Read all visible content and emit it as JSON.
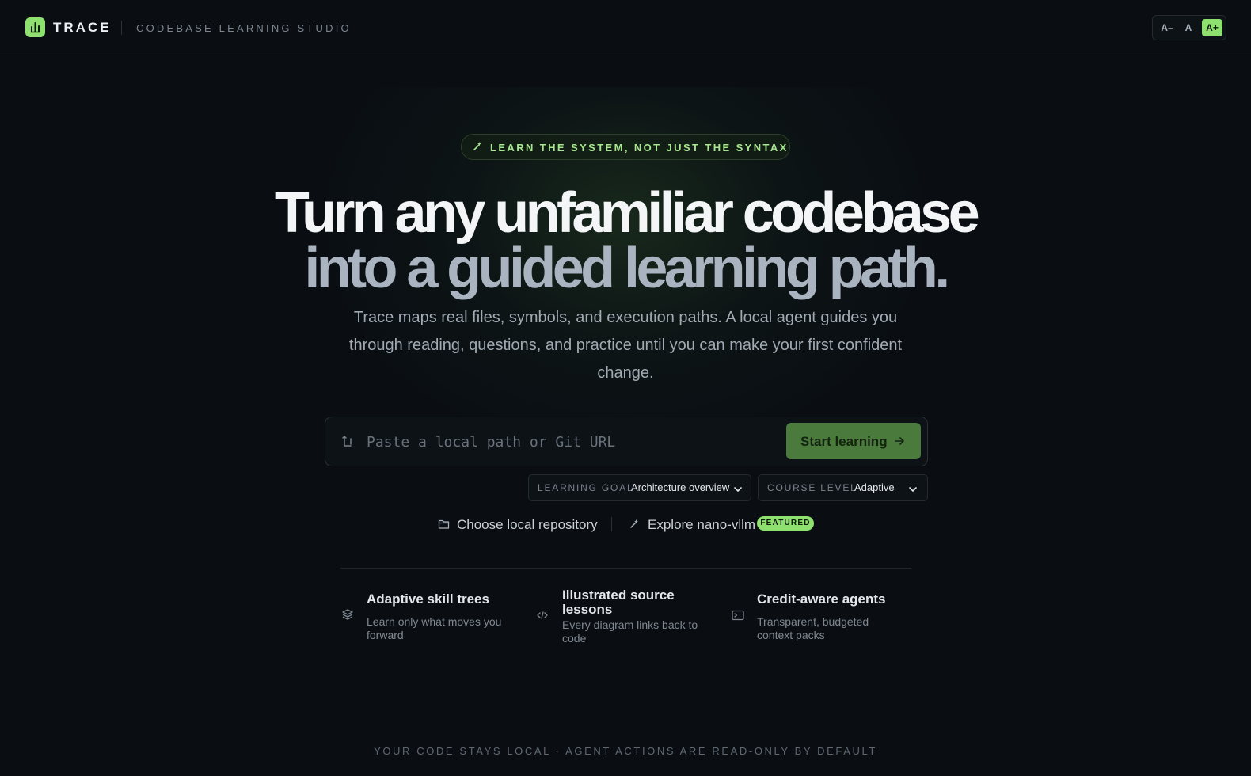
{
  "header": {
    "brand": "TRACE",
    "subtitle": "CODEBASE LEARNING STUDIO",
    "font_controls": [
      "A–",
      "A",
      "A+"
    ],
    "active_font_control": "A+"
  },
  "hero": {
    "eyebrow": "LEARN THE SYSTEM, NOT JUST THE SYNTAX",
    "headline_line1": "Turn any unfamiliar codebase",
    "headline_line2": "into a guided learning path.",
    "description": "Trace maps real files, symbols, and execution paths. A local agent guides you through reading, questions, and practice until you can make your first confident change."
  },
  "search": {
    "placeholder": "Paste a local path or Git URL",
    "value": "",
    "button_label": "Start learning"
  },
  "selectors": {
    "goal": {
      "label": "LEARNING GOAL",
      "value": "Architecture overview"
    },
    "level": {
      "label": "COURSE LEVEL",
      "value": "Adaptive"
    }
  },
  "links": {
    "choose_repo": "Choose local repository",
    "explore": "Explore nano-vllm",
    "badge": "FEATURED"
  },
  "features": [
    {
      "title": "Adaptive skill trees",
      "desc": "Learn only what moves you forward",
      "icon": "layers-icon"
    },
    {
      "title": "Illustrated source lessons",
      "desc": "Every diagram links back to code",
      "icon": "code-icon"
    },
    {
      "title": "Credit-aware agents",
      "desc": "Transparent, budgeted context packs",
      "icon": "terminal-icon"
    }
  ],
  "footer": "YOUR CODE STAYS LOCAL · AGENT ACTIONS ARE READ-ONLY BY DEFAULT",
  "colors": {
    "accent": "#8ee06f",
    "button": "#4a7a3c",
    "background": "#0a0e13"
  }
}
